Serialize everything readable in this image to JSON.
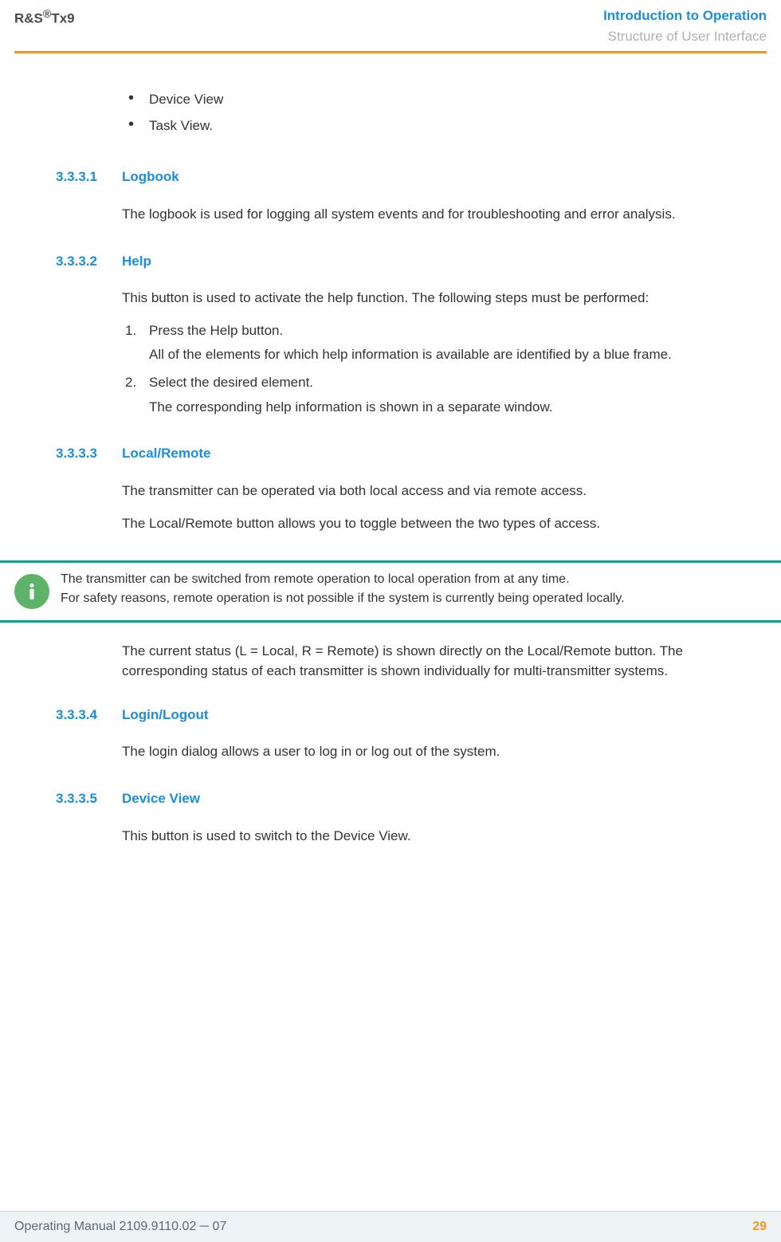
{
  "header": {
    "product_prefix": "R&S",
    "product_suffix": "Tx9",
    "chapter": "Introduction to Operation",
    "section": "Structure of User Interface"
  },
  "intro_bullets": [
    "Device View",
    "Task View."
  ],
  "sections": [
    {
      "num": "3.3.3.1",
      "title": "Logbook",
      "paras": [
        "The logbook is used for logging all system events and for troubleshooting and error analysis."
      ]
    },
    {
      "num": "3.3.3.2",
      "title": "Help",
      "paras": [
        "This button is used to activate the help function. The following steps must be performed:"
      ],
      "steps": [
        {
          "main": "Press the Help button.",
          "sub": "All of the elements for which help information is available are identified by a blue frame."
        },
        {
          "main": "Select the desired element.",
          "sub": "The corresponding help information is shown in a separate window."
        }
      ]
    },
    {
      "num": "3.3.3.3",
      "title": "Local/Remote",
      "paras": [
        "The transmitter can be operated via both local access and via remote access.",
        "The Local/Remote button allows you to toggle between the two types of access."
      ],
      "info": [
        "The transmitter can be switched from remote operation to local operation from at any time.",
        "For safety reasons, remote operation is not possible if the system is currently being operated locally."
      ],
      "after": [
        "The current status (L = Local, R = Remote) is shown directly on the Local/Remote button. The corresponding status of each transmitter is shown individually for multi-transmitter systems."
      ]
    },
    {
      "num": "3.3.3.4",
      "title": "Login/Logout",
      "paras": [
        "The login dialog allows a user to log in or log out of the system."
      ]
    },
    {
      "num": "3.3.3.5",
      "title": "Device View",
      "paras": [
        "This button is used to switch to the Device View."
      ]
    }
  ],
  "footer": {
    "left": "Operating Manual 2109.9110.02 ─ 07",
    "page": "29"
  }
}
